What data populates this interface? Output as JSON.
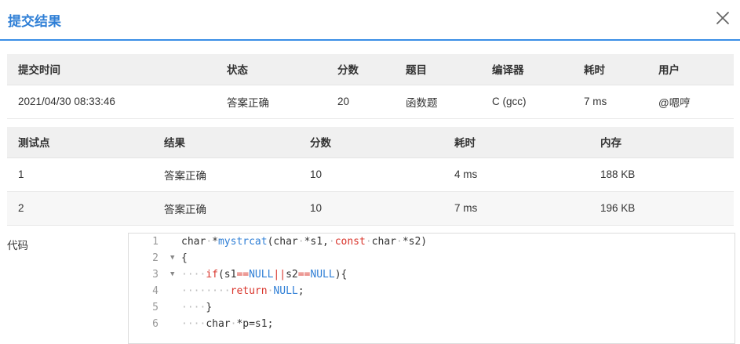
{
  "dialog": {
    "title": "提交结果"
  },
  "submission": {
    "headers": [
      "提交时间",
      "状态",
      "分数",
      "题目",
      "编译器",
      "耗时",
      "用户"
    ],
    "row": [
      "2021/04/30 08:33:46",
      "答案正确",
      "20",
      "函数题",
      "C (gcc)",
      "7 ms",
      "@嗯哼"
    ]
  },
  "testcases": {
    "headers": [
      "测试点",
      "结果",
      "分数",
      "耗时",
      "内存"
    ],
    "rows": [
      [
        "1",
        "答案正确",
        "10",
        "4 ms",
        "188 KB"
      ],
      [
        "2",
        "答案正确",
        "10",
        "7 ms",
        "196 KB"
      ]
    ]
  },
  "code": {
    "label": "代码",
    "lines": [
      "char *mystrcat(char *s1, const char *s2)",
      "{",
      "    if(s1==NULL||s2==NULL){",
      "        return NULL;",
      "    }",
      "    char *p=s1;"
    ],
    "line_numbers": [
      "1",
      "2",
      "3",
      "4",
      "5",
      "6"
    ]
  },
  "colors": {
    "accent": "#2f7fd6",
    "status_ok": "#d9342b"
  },
  "icons": {
    "close": "close-icon",
    "fold": "fold-arrow-icon"
  }
}
